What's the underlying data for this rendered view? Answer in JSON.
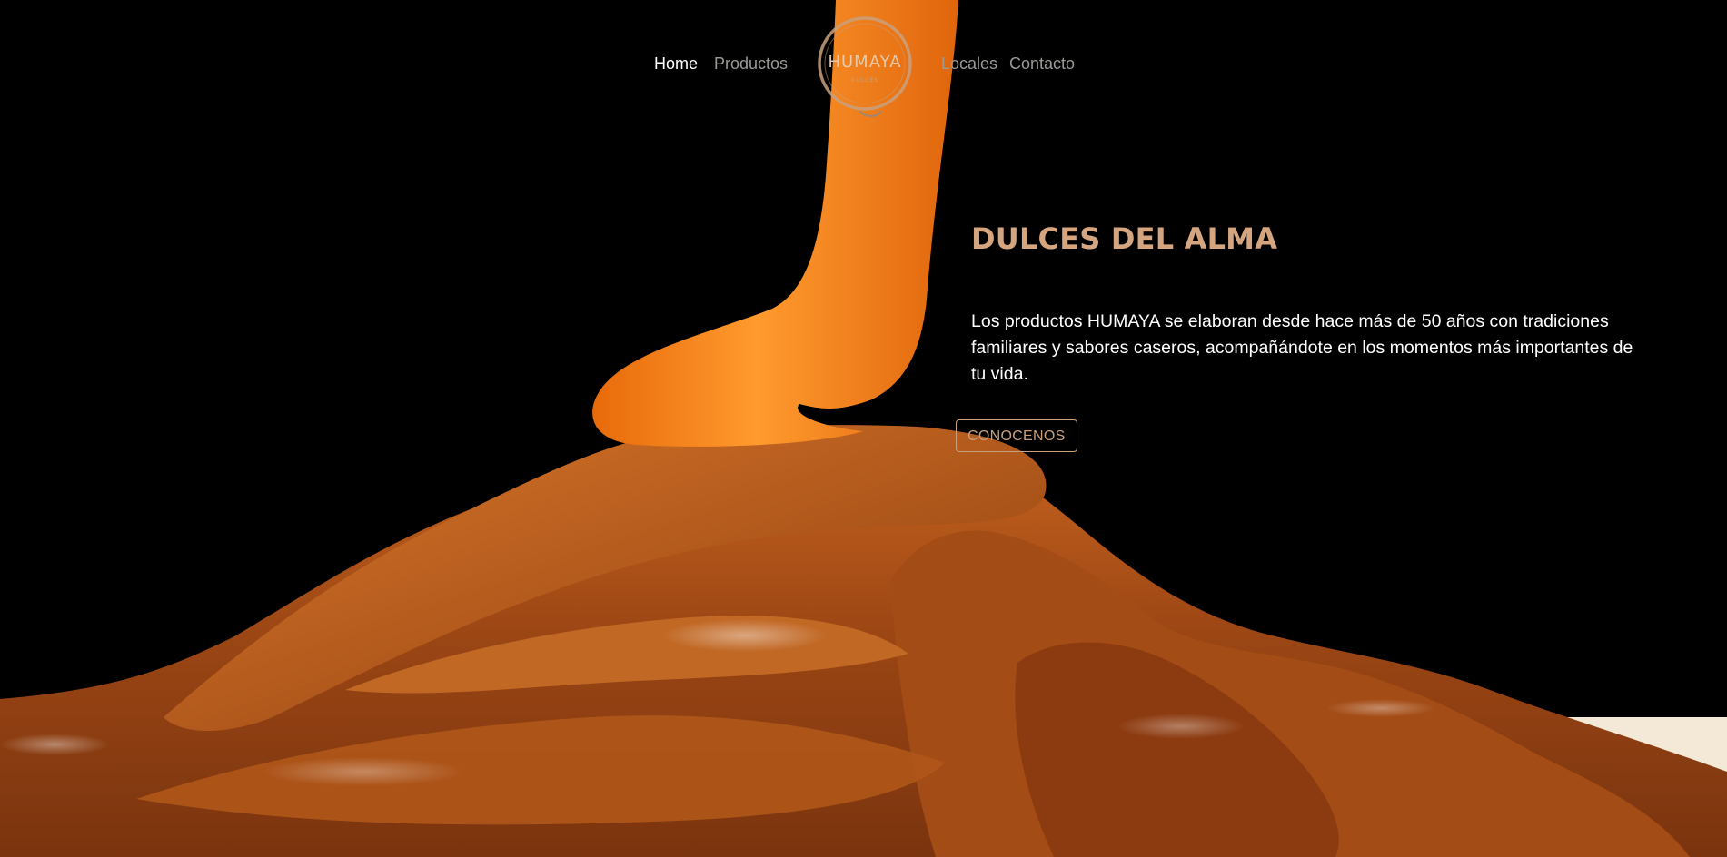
{
  "nav": {
    "items": [
      {
        "label": "Home",
        "active": true
      },
      {
        "label": "Productos",
        "active": false
      },
      {
        "label": "Locales",
        "active": false
      },
      {
        "label": "Contacto",
        "active": false
      }
    ]
  },
  "logo": {
    "brand": "HUMAYA",
    "tagline": "DULCES"
  },
  "hero": {
    "title": "DULCES DEL ALMA",
    "description": "Los productos HUMAYA se elaboran desde hace más de 50 años con tradiciones familiares y sabores caseros, acompañándote en los momentos más importantes de tu vida.",
    "cta_label": "CONOCENOS"
  },
  "colors": {
    "background": "#000000",
    "accent": "#d4a57f",
    "nav_inactive": "#9c9a97",
    "nav_active": "#ffffff",
    "caramel": "#b5561a",
    "caramel_stream": "#f07a12"
  }
}
